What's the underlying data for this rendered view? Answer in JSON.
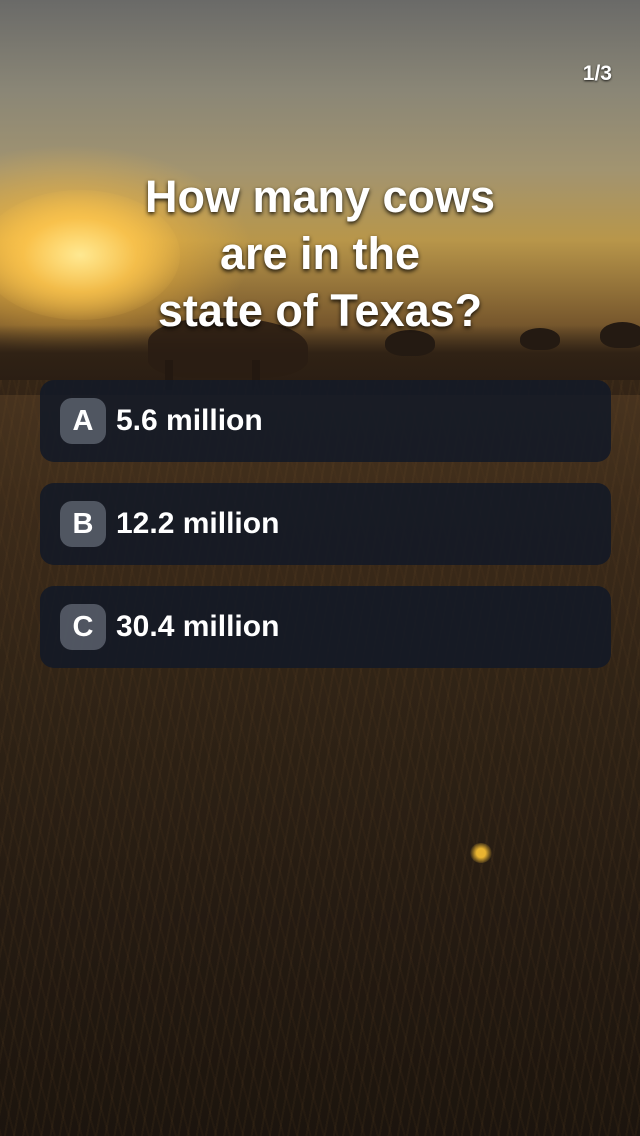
{
  "progress": {
    "counter": "1/3"
  },
  "question": {
    "lines": [
      "How many cows",
      "are in the",
      "state of Texas?"
    ]
  },
  "answers": [
    {
      "letter": "A",
      "text": "5.6 million"
    },
    {
      "letter": "B",
      "text": "12.2 million"
    },
    {
      "letter": "C",
      "text": "30.4 million"
    }
  ],
  "colors": {
    "answer_bg": "#121926",
    "letter_bg": "#5a606c",
    "text": "#ffffff"
  },
  "background": {
    "icon": "sunset-field-with-cow-image"
  }
}
